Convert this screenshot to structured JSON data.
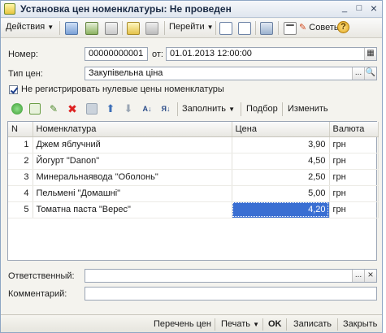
{
  "window": {
    "title": "Установка цен номенклатуры: Не проведен",
    "minimize": "_",
    "maximize": "□",
    "close": "×"
  },
  "toolbar": {
    "actions": "Действия",
    "goto": "Перейти",
    "tips": "Советы",
    "help": "?"
  },
  "form": {
    "number_label": "Номер:",
    "number_value": "00000000001",
    "date_label": "от:",
    "date_value": "01.01.2013 12:00:00",
    "price_type_label": "Тип цен:",
    "price_type_value": "Закупівельна ціна",
    "checkbox_label": "Не регистрировать нулевые цены номенклатуры",
    "dots": "...",
    "clear": "×"
  },
  "table_toolbar": {
    "fill": "Заполнить",
    "select": "Подбор",
    "change": "Изменить"
  },
  "table": {
    "columns": [
      "N",
      "Номенклатура",
      "Цена",
      "Валюта"
    ],
    "rows": [
      {
        "n": "1",
        "name": "Джем яблучний",
        "price": "3,90",
        "currency": "грн"
      },
      {
        "n": "2",
        "name": "Йогурт \"Danon\"",
        "price": "4,50",
        "currency": "грн"
      },
      {
        "n": "3",
        "name": "Минеральнаявода \"Оболонь\"",
        "price": "2,50",
        "currency": "грн"
      },
      {
        "n": "4",
        "name": "Пельмені \"Домашні\"",
        "price": "5,00",
        "currency": "грн"
      },
      {
        "n": "5",
        "name": "Томатна паста \"Верес\"",
        "price": "4,20",
        "currency": "грн"
      }
    ]
  },
  "footer_fields": {
    "responsible_label": "Ответственный:",
    "responsible_value": "",
    "comment_label": "Комментарий:",
    "comment_value": ""
  },
  "bottom_bar": {
    "price_list": "Перечень цен",
    "print": "Печать",
    "ok": "OK",
    "save": "Записать",
    "close": "Закрыть"
  },
  "colors": {
    "selection": "#3a6fd2",
    "window_bg": "#f4f3ee"
  }
}
